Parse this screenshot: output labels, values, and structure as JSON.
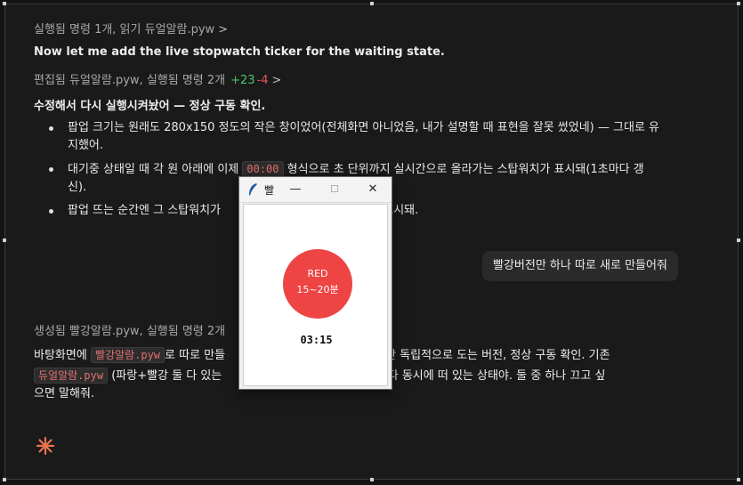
{
  "messages": {
    "meta1": {
      "label": "실행됨 명령 1개, 읽기 듀얼알람.pyw",
      "chevron": ">"
    },
    "assistant_line": "Now let me add the live stopwatch ticker for the waiting state.",
    "meta2": {
      "label": "편집됨 듀얼알람.pyw, 실행됨 명령 2개",
      "added": "+23",
      "removed": "-4",
      "chevron": ">"
    },
    "heading": "수정해서 다시 실행시켜놨어 — 정상 구동 확인.",
    "bullets": [
      {
        "line1": "팝업 크기는 원래도 280x150 정도의 작은 창이었어(전체화면 아니었음, 내가 설명할 때 표현을 잘못 썼었네) — 그대로 유",
        "line2": "지했어."
      },
      {
        "pre": "대기중 상태일 때 각 원 아래에 이제",
        "code": "00:00",
        "post": "형식으로 초 단위까지 실시간으로 올라가는 스탑워치가 표시돼(1초마다 갱",
        "line2": "신)."
      },
      {
        "pre": "팝업 뜨는 순간엔 그 스탑워치가 ",
        "post": "이 표시돼."
      }
    ],
    "user_request": "빨강버전만 하나 따로 새로 만들어줘",
    "meta3": {
      "label": "생성됨 빨강알람.pyw, 실행됨 명령 2개"
    },
    "para": {
      "pre1": "바탕화면에",
      "code1": "빨강알람.pyw",
      "mid1": "로 따로 만들",
      "post1": "알람 하나만 독립적으로 도는 버전, 정상 구동 확인. 기존",
      "code2": "듀얼알람.pyw",
      "mid2": "(파랑+빨강 둘 다 있는 ",
      "post2": "니, 지금 둘 다 동시에 떠 있는 상태야. 둘 중 하나 끄고 싶",
      "line3": "으면 말해줘."
    }
  },
  "popup": {
    "title": "빨",
    "minimize": "—",
    "maximize": "☐",
    "close": "✕",
    "circle_line1": "RED",
    "circle_line2": "15~20분",
    "timer": "03:15",
    "circle_color": "#ee4444"
  },
  "colors": {
    "accent_spark": "#e8734d",
    "added": "#4cc36b",
    "removed": "#e4525d"
  }
}
